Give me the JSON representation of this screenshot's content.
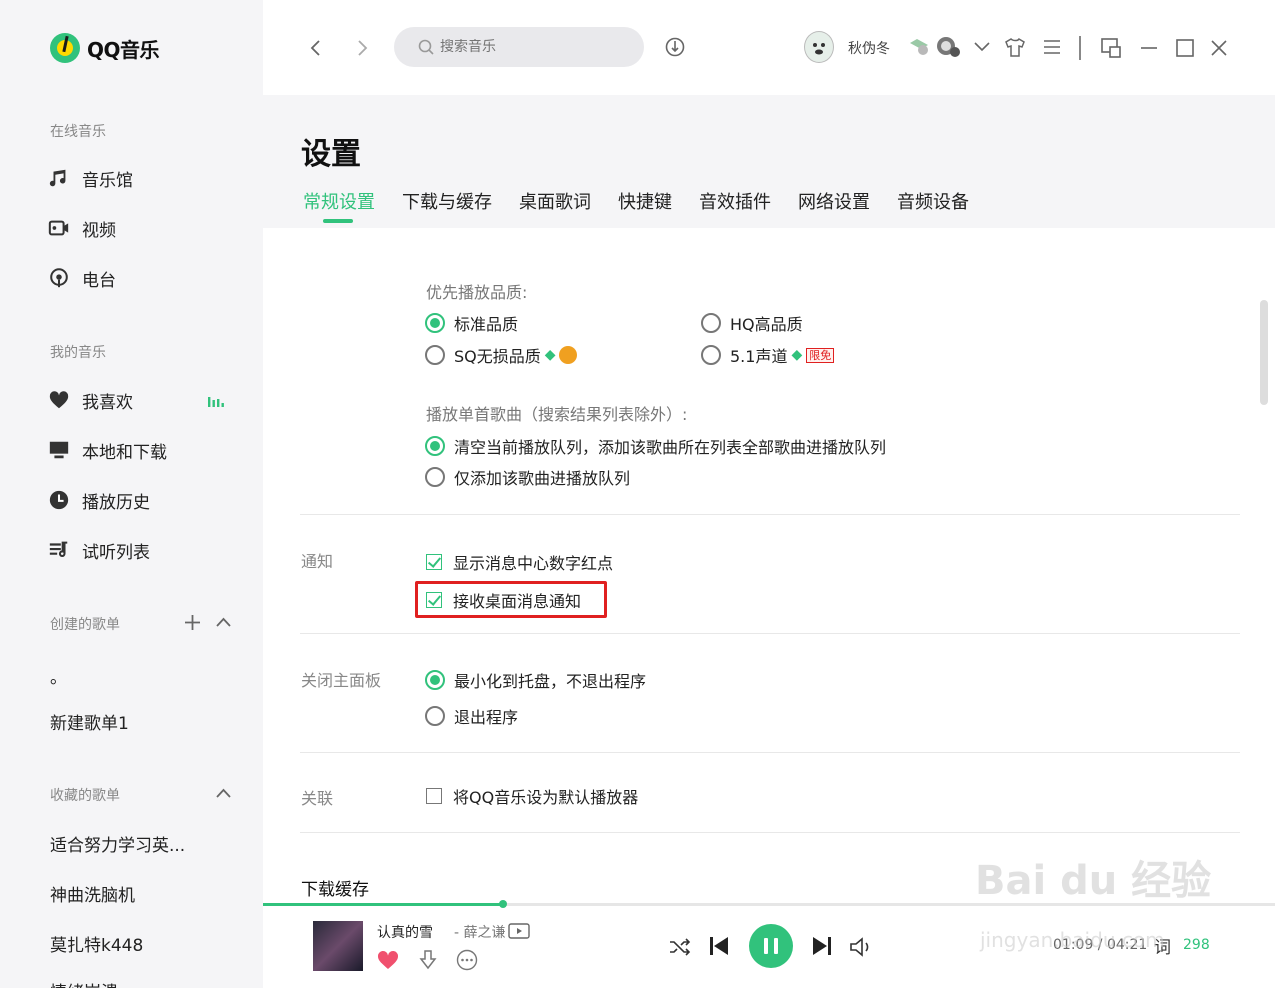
{
  "app": {
    "name": "QQ音乐",
    "brand_color": "#31c27c"
  },
  "sidebar": {
    "online_title": "在线音乐",
    "online_items": [
      {
        "label": "音乐馆",
        "icon": "music-note-icon"
      },
      {
        "label": "视频",
        "icon": "video-icon"
      },
      {
        "label": "电台",
        "icon": "radio-icon"
      }
    ],
    "my_title": "我的音乐",
    "my_items": [
      {
        "label": "我喜欢",
        "icon": "heart-icon"
      },
      {
        "label": "本地和下载",
        "icon": "monitor-icon"
      },
      {
        "label": "播放历史",
        "icon": "clock-icon"
      },
      {
        "label": "试听列表",
        "icon": "playlist-icon"
      }
    ],
    "created_title": "创建的歌单",
    "created_items": [
      "。",
      "新建歌单1"
    ],
    "collected_title": "收藏的歌单",
    "collected_items": [
      "适合努力学习英...",
      "神曲洗脑机",
      "莫扎特k448",
      "情绪崩溃"
    ]
  },
  "topbar": {
    "search_placeholder": "搜索音乐",
    "username": "秋伪冬"
  },
  "settings": {
    "title": "设置",
    "tabs": [
      "常规设置",
      "下载与缓存",
      "桌面歌词",
      "快捷键",
      "音效插件",
      "网络设置",
      "音频设备"
    ],
    "quality_label": "优先播放品质:",
    "quality_options": [
      "标准品质",
      "HQ高品质",
      "SQ无损品质",
      "5.1声道"
    ],
    "quality_free_badge": "限免",
    "song_label": "播放单首歌曲（搜索结果列表除外）:",
    "song_options": [
      "清空当前播放队列，添加该歌曲所在列表全部歌曲进播放队列",
      "仅添加该歌曲进播放队列"
    ],
    "notify_label": "通知",
    "notify_options": [
      "显示消息中心数字红点",
      "接收桌面消息通知"
    ],
    "close_label": "关闭主面板",
    "close_options": [
      "最小化到托盘，不退出程序",
      "退出程序"
    ],
    "assoc_label": "关联",
    "assoc_options": [
      "将QQ音乐设为默认播放器"
    ],
    "next_section": "下载缓存"
  },
  "player": {
    "song_title": "认真的雪",
    "artist": "- 薛之谦",
    "time": "01:09 / 04:21",
    "lyric_label": "词",
    "progress": 0.237,
    "count": "298"
  },
  "watermark": {
    "main": "Bai du 经验",
    "sub": "jingyan.baidu.com"
  }
}
